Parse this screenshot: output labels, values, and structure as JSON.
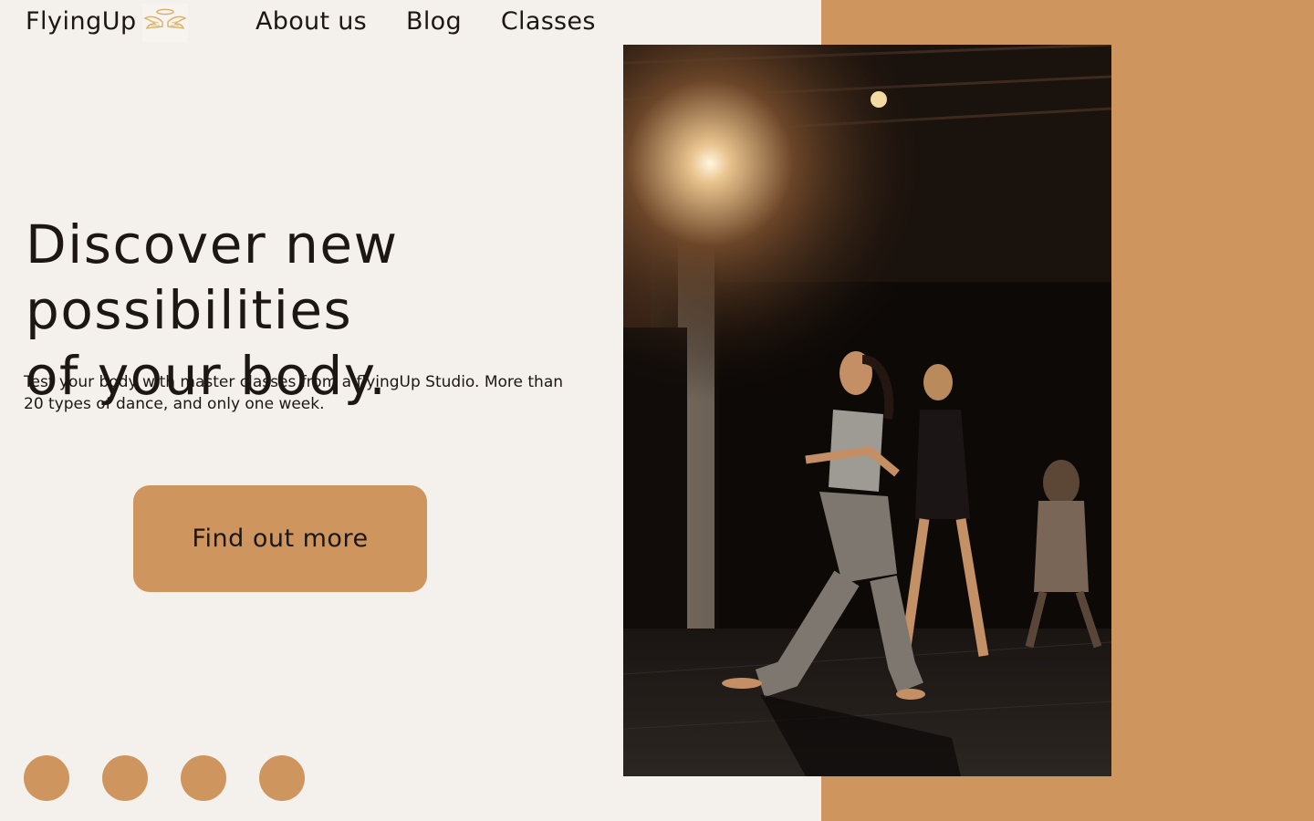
{
  "brand": {
    "name": "FlyingUp",
    "logo_icon": "angel-wings-halo-icon"
  },
  "nav": {
    "items": [
      {
        "label": "About us"
      },
      {
        "label": "Blog"
      },
      {
        "label": "Classes"
      }
    ]
  },
  "hero": {
    "headline_line1": "Discover new possibilities",
    "headline_line2": "of your body.",
    "description": "Test your body with master classes from a flyingUp Studio. More than 20 types of dance, and only one week.",
    "cta_label": "Find out more",
    "image": "dance-class-photo"
  },
  "carousel": {
    "dots": [
      {},
      {},
      {},
      {}
    ]
  },
  "colors": {
    "background": "#f4f0ec",
    "accent": "#cf955e",
    "text": "#1c1712"
  }
}
